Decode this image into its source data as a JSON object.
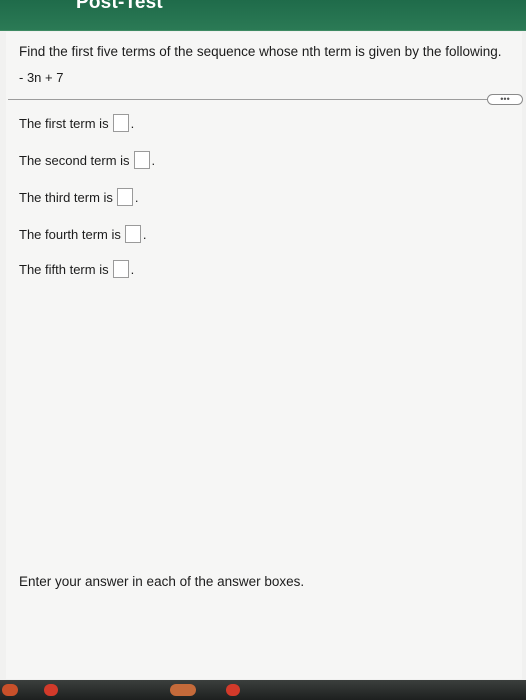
{
  "header": {
    "title": "Post-Test"
  },
  "question": {
    "prompt": "Find the first five terms of the sequence whose nth term is given by the following.",
    "expression": "- 3n + 7"
  },
  "expand_handle": {
    "label": "•••"
  },
  "answers": [
    {
      "label": "The first term is",
      "value": ""
    },
    {
      "label": "The second term is",
      "value": ""
    },
    {
      "label": "The third term is",
      "value": ""
    },
    {
      "label": "The fourth term is",
      "value": ""
    },
    {
      "label": "The fifth term is",
      "value": ""
    }
  ],
  "instruction": "Enter your answer in each of the answer boxes.",
  "colors": {
    "header_green": "#2b7a55",
    "panel_bg": "#f6f6f5"
  }
}
